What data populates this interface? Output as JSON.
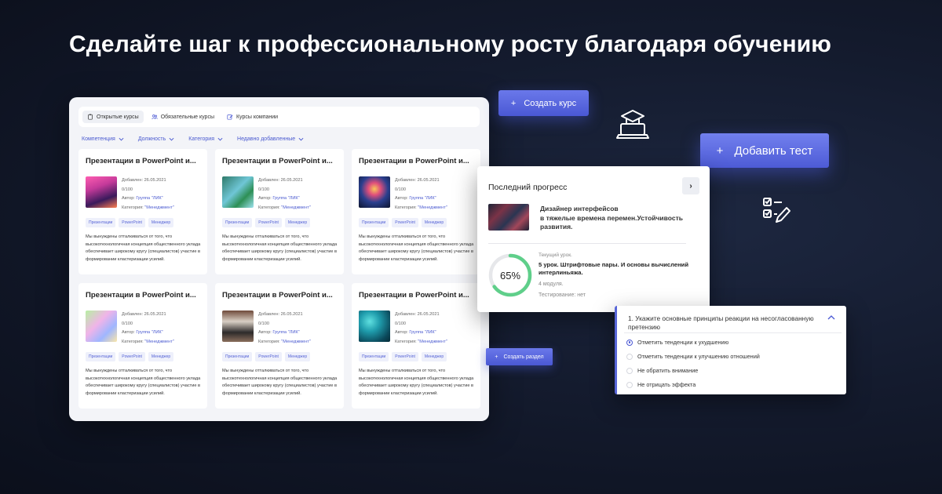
{
  "headline": "Сделайте шаг к профессиональному росту благодаря обучению",
  "tabs": [
    {
      "label": "Открытые курсы",
      "icon": "clipboard-icon"
    },
    {
      "label": "Обязательные курсы",
      "icon": "users-icon"
    },
    {
      "label": "Курсы компании",
      "icon": "edit-icon"
    }
  ],
  "filters": [
    "Компетенция",
    "Должность",
    "Категория",
    "Недавно добавленные"
  ],
  "card_common": {
    "title": "Презентации в PowerPoint и...",
    "added": "Добавлен: 26.05.2021",
    "score": "0/100",
    "author_prefix": "Автор:",
    "author": "Группа \"ЛИК\"",
    "category_prefix": "Категория:",
    "category": "\"Менеджмент\"",
    "tags": [
      "Презентации",
      "PowerPoint",
      "Менеджер"
    ],
    "description": "Мы вынуждены отталкиваться от того, что высокотехнологичная концепция общественного уклада обеспечивает широкому кругу (специалистов) участие в формировании кластеризации усилий."
  },
  "buttons": {
    "create_course": "Создать курс",
    "add_test": "Добавить тест",
    "create_section": "Создать раздел",
    "plus": "+"
  },
  "progress": {
    "title": "Последний прогресс",
    "arrow": "›",
    "course_name": "Дизайнер интерфейсов\nв тяжелые времена перемен.Устойчивость развития.",
    "percent_label": "65%",
    "percent_value": 65,
    "current_lesson_label": "Текущий урок.",
    "current_lesson": "5 урок. Штрифтовые пары. И основы вычислений интерлиньяжа.",
    "modules": "4 модуля.",
    "testing": "Тестирование: нет",
    "ring_color": "#5fcf8a"
  },
  "quiz": {
    "question": "1. Укажите основные принципы реакции на несогласованную претензию",
    "options": [
      "Отметить тенденции к ухудшению",
      "Отметить тенденции к улучшению отношений",
      "Не обратить внимание",
      "Не отрицать эффекта"
    ],
    "selected": 0
  },
  "colors": {
    "accent": "#4a58d4",
    "link": "#4a5ad0",
    "background": "#141b2e"
  }
}
